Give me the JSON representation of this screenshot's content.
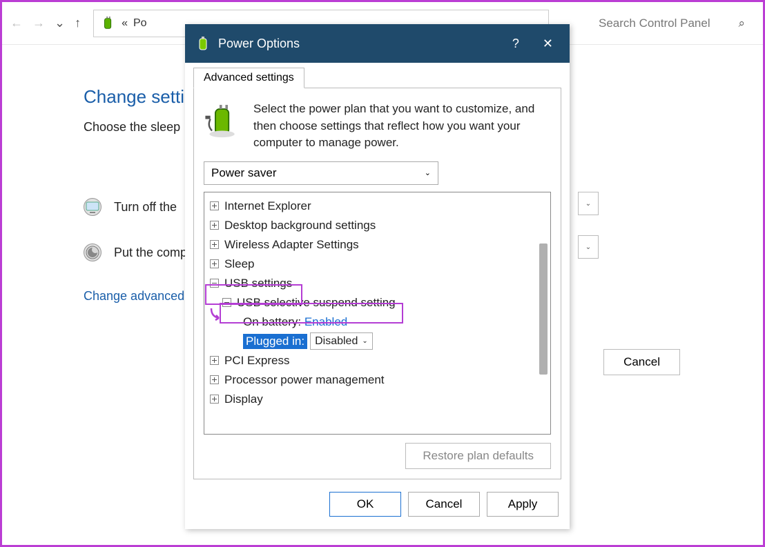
{
  "background": {
    "breadcrumb_prefix": "«",
    "breadcrumb_text": "Po",
    "search_placeholder": "Search Control Panel",
    "title": "Change setti",
    "subtitle": "Choose the sleep",
    "row1": "Turn off the ",
    "row2": "Put the comp",
    "link": "Change advanced",
    "cancel": "Cancel"
  },
  "dialog": {
    "title": "Power Options",
    "tab": "Advanced settings",
    "description": "Select the power plan that you want to customize, and then choose settings that reflect how you want your computer to manage power.",
    "plan": "Power saver",
    "tree": {
      "ie": "Internet Explorer",
      "desktop": "Desktop background settings",
      "wireless": "Wireless Adapter Settings",
      "sleep": "Sleep",
      "usb": "USB settings",
      "usb_child": "USB selective suspend setting",
      "on_battery_label": "On battery:",
      "on_battery_value": "Enabled",
      "plugged_in_label": "Plugged in:",
      "plugged_in_value": "Disabled",
      "pci": "PCI Express",
      "proc": "Processor power management",
      "display": "Display"
    },
    "restore": "Restore plan defaults",
    "ok": "OK",
    "cancel": "Cancel",
    "apply": "Apply"
  }
}
